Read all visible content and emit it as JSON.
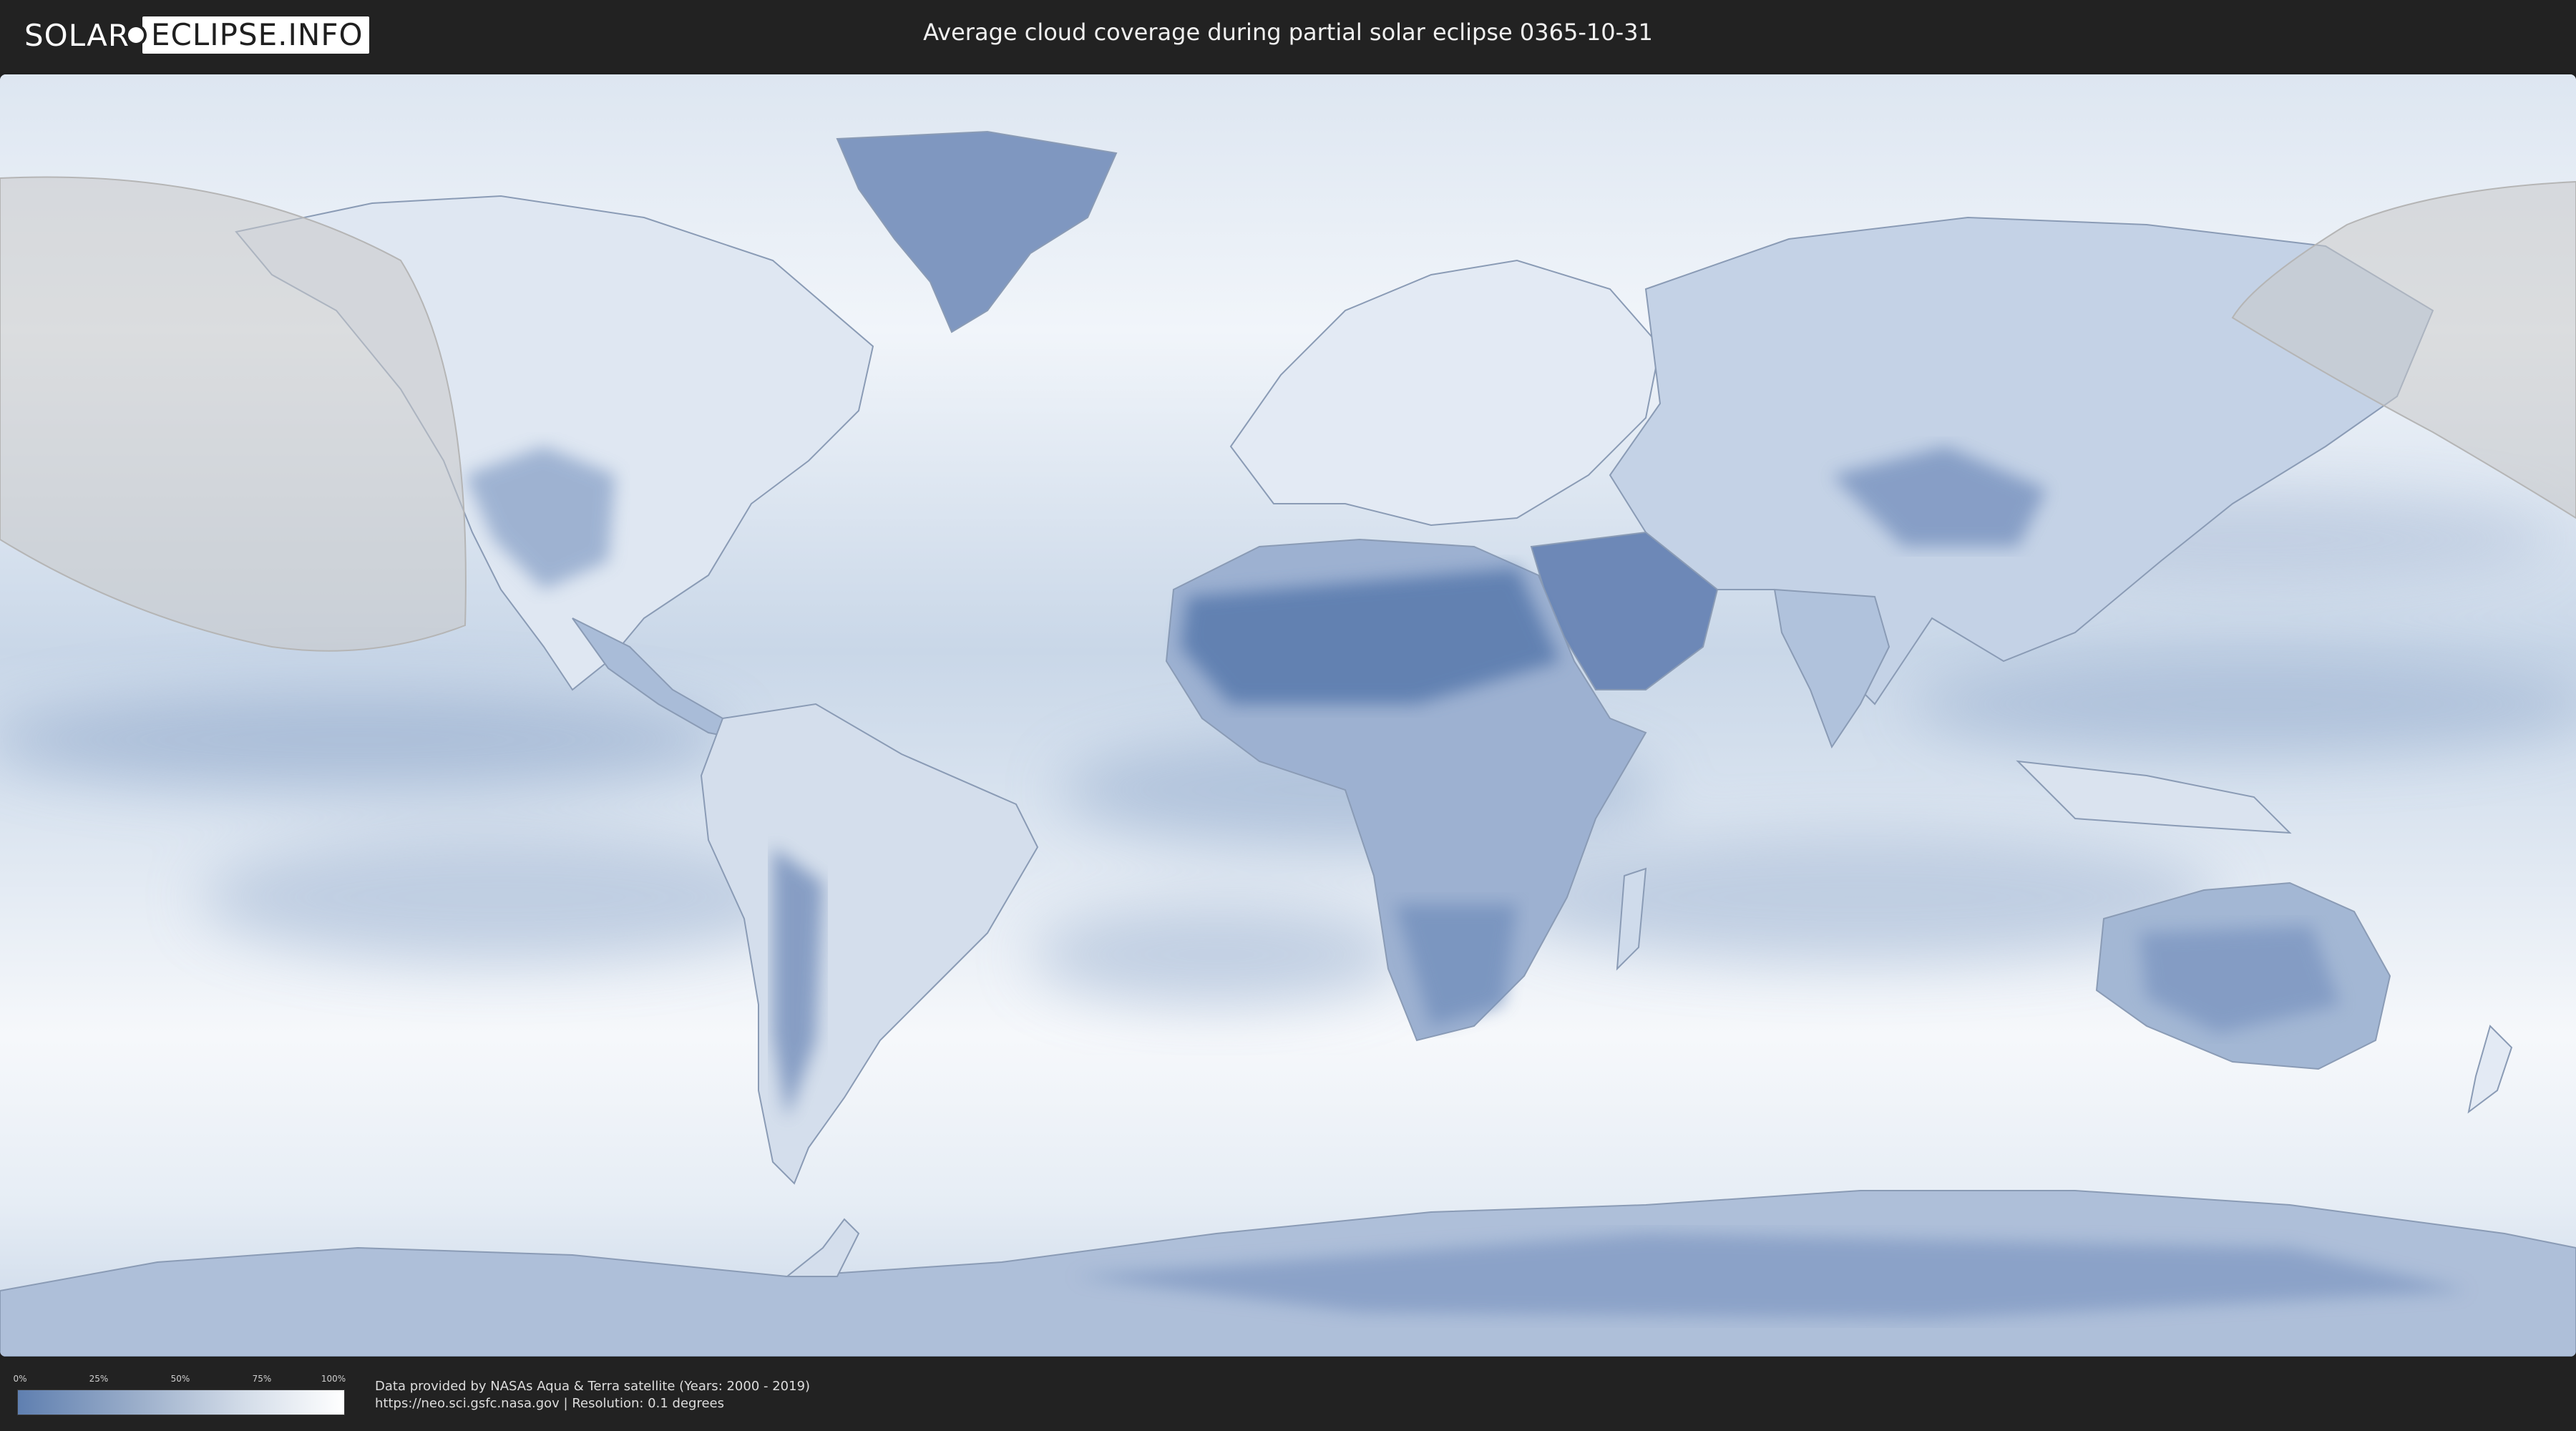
{
  "header": {
    "logo_solar": "SOLAR",
    "logo_eclipse": "ECLIPSE.INFO",
    "title": "Average cloud coverage during partial solar eclipse 0365-10-31"
  },
  "map": {
    "description_colors": {
      "ocean_cloudy": "#f4f7fb",
      "clear_sky": "#6a88b8",
      "eclipse_overlay": "#c8c8c8"
    }
  },
  "legend": {
    "ticks": [
      "0%",
      "25%",
      "50%",
      "75%",
      "100%"
    ],
    "gradient_start": "#5f7fb0",
    "gradient_end": "#ffffff"
  },
  "footer": {
    "credit_line1": "Data provided by NASAs Aqua & Terra satellite (Years: 2000 - 2019)",
    "credit_line2": "https://neo.sci.gsfc.nasa.gov | Resolution: 0.1 degrees"
  }
}
